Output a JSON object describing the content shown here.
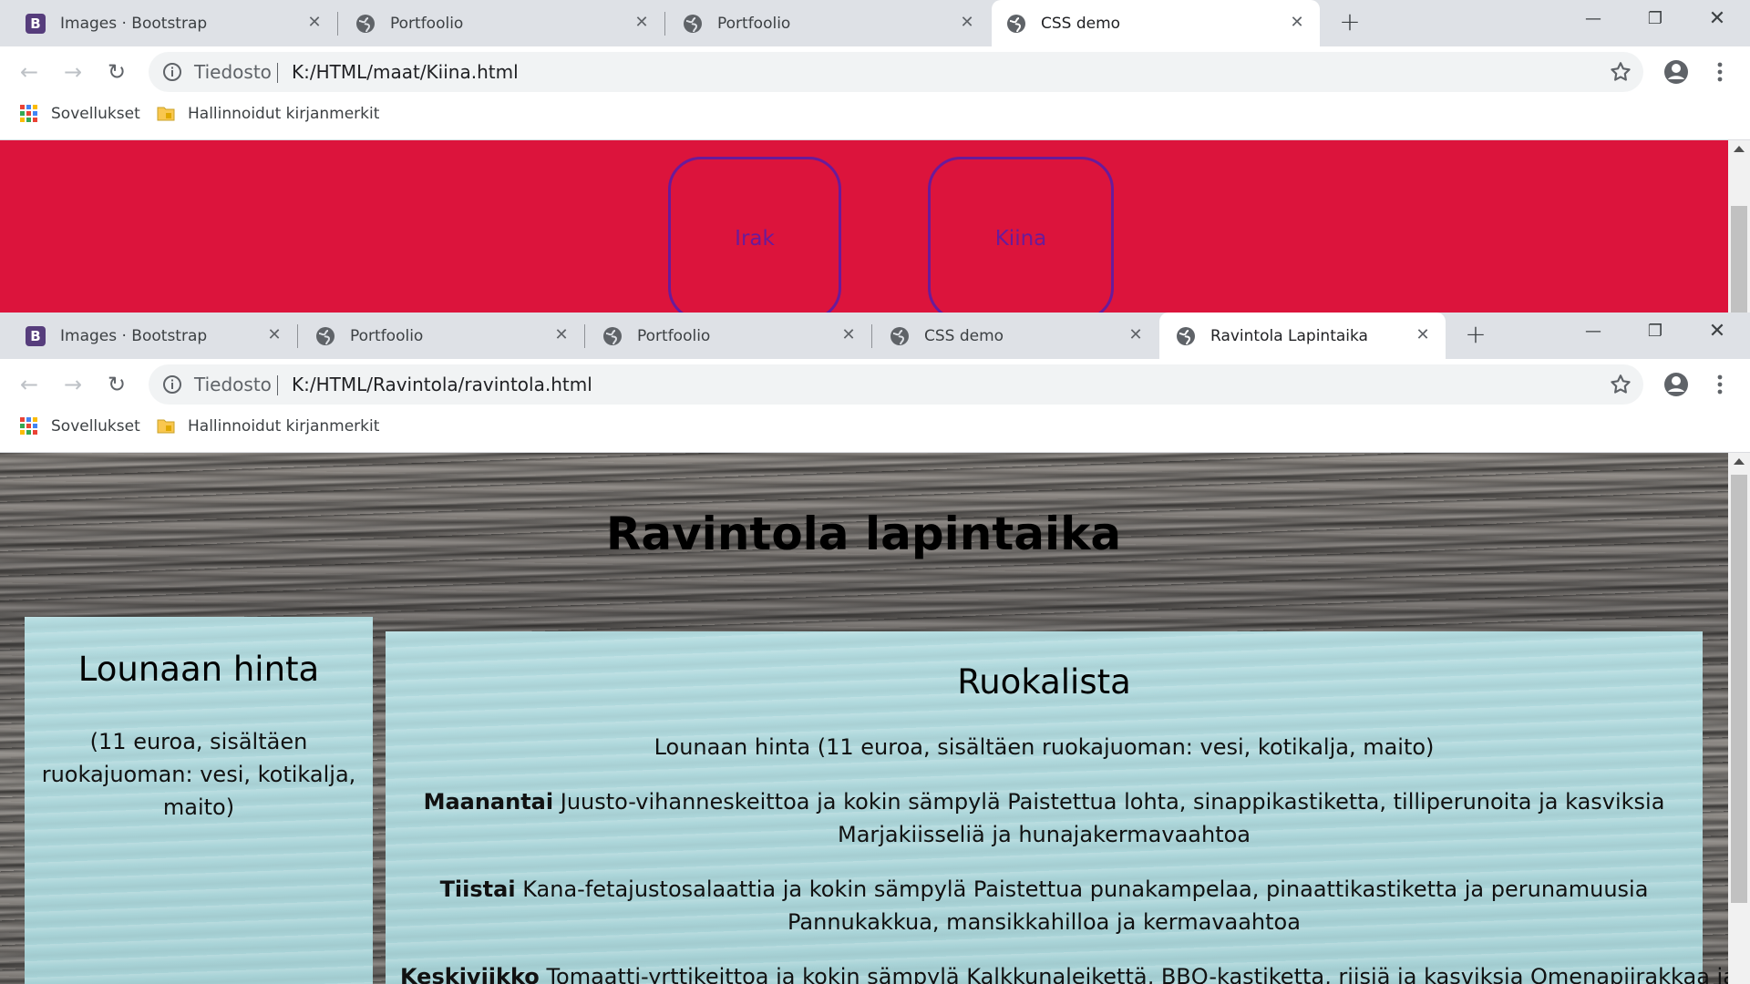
{
  "window1": {
    "tabs": [
      {
        "title": "Images · Bootstrap"
      },
      {
        "title": "Portfoolio"
      },
      {
        "title": "Portfoolio"
      },
      {
        "title": "CSS demo"
      }
    ],
    "omnibox": {
      "protocol": "Tiedosto",
      "url": "K:/HTML/maat/Kiina.html"
    },
    "bookmarks": {
      "apps": "Sovellukset",
      "managed": "Hallinnoidut kirjanmerkit"
    },
    "page": {
      "buttons": [
        {
          "label": "Irak"
        },
        {
          "label": "Kiina"
        }
      ],
      "colors": {
        "background": "#dc143c",
        "button_border": "#6a1b9a"
      }
    }
  },
  "window2": {
    "tabs": [
      {
        "title": "Images · Bootstrap"
      },
      {
        "title": "Portfoolio"
      },
      {
        "title": "Portfoolio"
      },
      {
        "title": "CSS demo"
      },
      {
        "title": "Ravintola Lapintaika"
      }
    ],
    "omnibox": {
      "protocol": "Tiedosto",
      "url": "K:/HTML/Ravintola/ravintola.html"
    },
    "bookmarks": {
      "apps": "Sovellukset",
      "managed": "Hallinnoidut kirjanmerkit"
    },
    "page": {
      "title": "Ravintola lapintaika",
      "side": {
        "heading": "Lounaan hinta",
        "text": "(11 euroa, sisältäen ruokajuoman: vesi, kotikalja, maito)"
      },
      "menu": {
        "heading": "Ruokalista",
        "intro": "Lounaan hinta (11 euroa, sisältäen ruokajuoman: vesi, kotikalja, maito)",
        "days": [
          {
            "day": "Maanantai",
            "line1": "Juusto-vihanneskeittoa ja kokin sämpylä Paistettua lohta, sinappikastiketta, tilliperunoita ja kasviksia",
            "line2": "Marjakiisseliä ja hunajakermavaahtoa"
          },
          {
            "day": "Tiistai",
            "line1": "Kana-fetajustosalaattia ja kokin sämpylä Paistettua punakampelaa, pinaattikastiketta ja perunamuusia",
            "line2": "Pannukakkua, mansikkahilloa ja kermavaahtoa"
          },
          {
            "day": "Keskiviikko",
            "line1": "Tomaatti-yrttikeittoa ja kokin sämpylä Kalkkunaleikettä, BBQ-kastiketta, riisiä ja kasviksia Omenapiirakkaa ja",
            "line2": ""
          }
        ]
      },
      "colors": {
        "panel": "#aad4d8",
        "text": "#000000"
      }
    }
  }
}
